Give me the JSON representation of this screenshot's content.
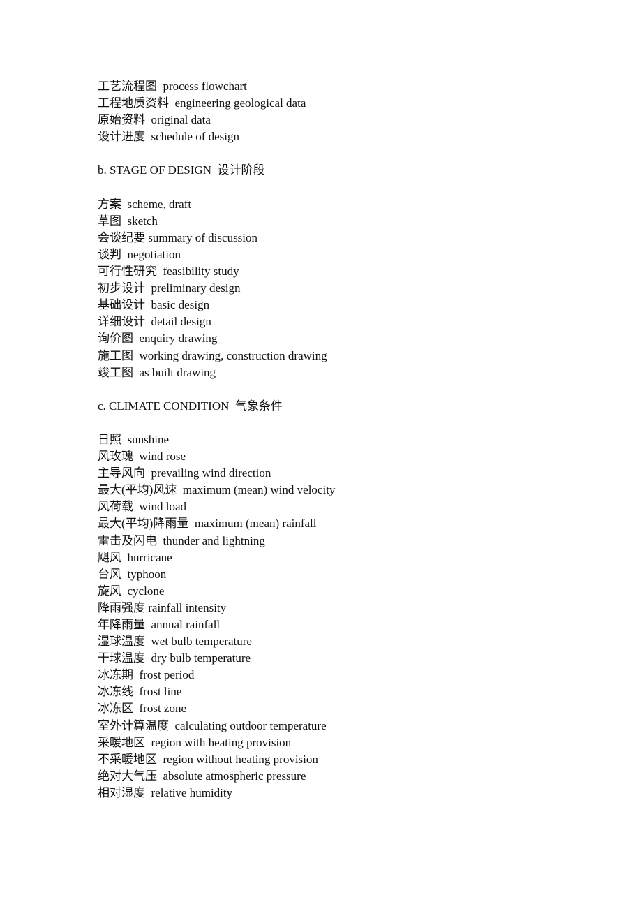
{
  "intro_entries": [
    {
      "zh": "工艺流程图",
      "sep": "  ",
      "en": "process flowchart"
    },
    {
      "zh": "工程地质资料",
      "sep": "  ",
      "en": "engineering geological data"
    },
    {
      "zh": "原始资料",
      "sep": "  ",
      "en": "original data"
    },
    {
      "zh": "设计进度",
      "sep": "  ",
      "en": "schedule of design"
    }
  ],
  "sections": [
    {
      "heading": "b. STAGE OF DESIGN  设计阶段",
      "entries": [
        {
          "zh": "方案",
          "sep": "  ",
          "en": "scheme, draft"
        },
        {
          "zh": "草图",
          "sep": "  ",
          "en": "sketch"
        },
        {
          "zh": "会谈纪要",
          "sep": " ",
          "en": "summary of discussion"
        },
        {
          "zh": "谈判",
          "sep": "  ",
          "en": "negotiation"
        },
        {
          "zh": "可行性研究",
          "sep": "  ",
          "en": "feasibility study"
        },
        {
          "zh": "初步设计",
          "sep": "  ",
          "en": "preliminary design"
        },
        {
          "zh": "基础设计",
          "sep": "  ",
          "en": "basic design"
        },
        {
          "zh": "详细设计",
          "sep": "  ",
          "en": "detail design"
        },
        {
          "zh": "询价图",
          "sep": "  ",
          "en": "enquiry drawing"
        },
        {
          "zh": "施工图",
          "sep": "  ",
          "en": "working drawing, construction drawing"
        },
        {
          "zh": "竣工图",
          "sep": "  ",
          "en": "as built drawing"
        }
      ]
    },
    {
      "heading": "c. CLIMATE CONDITION  气象条件",
      "entries": [
        {
          "zh": "日照",
          "sep": "  ",
          "en": "sunshine"
        },
        {
          "zh": "风玫瑰",
          "sep": "  ",
          "en": "wind rose"
        },
        {
          "zh": "主导风向",
          "sep": "  ",
          "en": "prevailing wind direction"
        },
        {
          "zh": "最大(平均)风速",
          "sep": "  ",
          "en": "maximum (mean) wind velocity"
        },
        {
          "zh": "风荷载",
          "sep": "  ",
          "en": "wind load"
        },
        {
          "zh": "最大(平均)降雨量",
          "sep": "  ",
          "en": "maximum (mean) rainfall"
        },
        {
          "zh": "雷击及闪电",
          "sep": "  ",
          "en": "thunder and lightning"
        },
        {
          "zh": "飓风",
          "sep": "  ",
          "en": "hurricane"
        },
        {
          "zh": "台风",
          "sep": "  ",
          "en": "typhoon"
        },
        {
          "zh": "旋风",
          "sep": "  ",
          "en": "cyclone"
        },
        {
          "zh": "降雨强度",
          "sep": " ",
          "en": "rainfall intensity"
        },
        {
          "zh": "年降雨量",
          "sep": "  ",
          "en": "annual rainfall"
        },
        {
          "zh": "湿球温度",
          "sep": "  ",
          "en": "wet bulb temperature"
        },
        {
          "zh": "干球温度",
          "sep": "  ",
          "en": "dry bulb temperature"
        },
        {
          "zh": "冰冻期",
          "sep": "  ",
          "en": "frost period"
        },
        {
          "zh": "冰冻线",
          "sep": "  ",
          "en": "frost line"
        },
        {
          "zh": "冰冻区",
          "sep": "  ",
          "en": "frost zone"
        },
        {
          "zh": "室外计算温度",
          "sep": "  ",
          "en": "calculating outdoor temperature"
        },
        {
          "zh": "采暖地区",
          "sep": "  ",
          "en": "region with heating provision"
        },
        {
          "zh": "不采暖地区",
          "sep": "  ",
          "en": "region without heating provision"
        },
        {
          "zh": "绝对大气压",
          "sep": "  ",
          "en": "absolute atmospheric pressure"
        },
        {
          "zh": "相对湿度",
          "sep": "  ",
          "en": "relative humidity"
        }
      ]
    }
  ]
}
